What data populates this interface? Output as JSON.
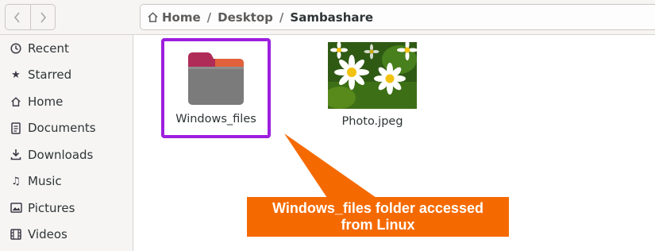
{
  "nav": {
    "back_icon": "chevron-left-icon",
    "forward_icon": "chevron-right-icon"
  },
  "breadcrumb": {
    "home": "Home",
    "separator": "/",
    "desktop": "Desktop",
    "current": "Sambashare"
  },
  "sidebar": {
    "items": [
      {
        "label": "Recent",
        "icon": "clock-icon"
      },
      {
        "label": "Starred",
        "icon": "star-icon"
      },
      {
        "label": "Home",
        "icon": "home-icon"
      },
      {
        "label": "Documents",
        "icon": "document-icon"
      },
      {
        "label": "Downloads",
        "icon": "download-icon"
      },
      {
        "label": "Music",
        "icon": "music-icon"
      },
      {
        "label": "Pictures",
        "icon": "picture-icon"
      },
      {
        "label": "Videos",
        "icon": "video-icon"
      }
    ]
  },
  "files": [
    {
      "name": "Windows_files",
      "type": "folder",
      "selected": true
    },
    {
      "name": "Photo.jpeg",
      "type": "image"
    }
  ],
  "annotation": {
    "line1": "Windows_files folder accessed",
    "line2": "from Linux"
  },
  "colors": {
    "highlight_border": "#9d1fde",
    "callout": "#f56a00",
    "folder_body": "#7b7b7b",
    "folder_tab": "#b02c58"
  }
}
